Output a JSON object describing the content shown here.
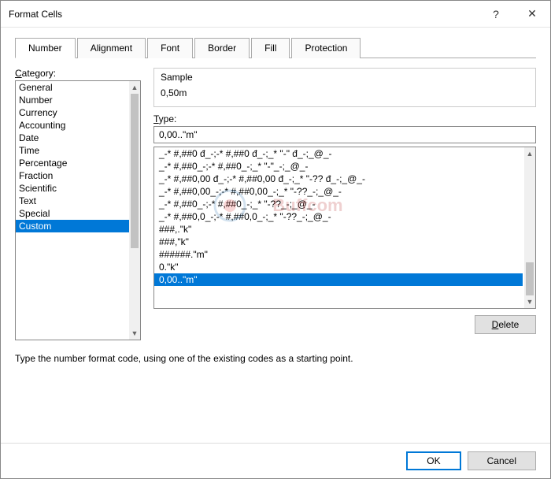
{
  "window": {
    "title": "Format Cells",
    "help_glyph": "?",
    "close_glyph": "✕"
  },
  "tabs": [
    {
      "id": "number",
      "label": "Number",
      "active": true
    },
    {
      "id": "alignment",
      "label": "Alignment",
      "active": false
    },
    {
      "id": "font",
      "label": "Font",
      "active": false
    },
    {
      "id": "border",
      "label": "Border",
      "active": false
    },
    {
      "id": "fill",
      "label": "Fill",
      "active": false
    },
    {
      "id": "protection",
      "label": "Protection",
      "active": false
    }
  ],
  "category": {
    "label": "Category:",
    "items": [
      "General",
      "Number",
      "Currency",
      "Accounting",
      "Date",
      "Time",
      "Percentage",
      "Fraction",
      "Scientific",
      "Text",
      "Special",
      "Custom"
    ],
    "selected_index": 11
  },
  "sample": {
    "label": "Sample",
    "value": "0,50m"
  },
  "type_field": {
    "label": "Type:",
    "value": "0,00..\"m\""
  },
  "format_list": {
    "items": [
      "_-* #,##0 đ_-;-* #,##0 đ_-;_* \"-\" đ_-;_@_-",
      "_-* #,##0_-;-* #,##0_-;_* \"-\"_-;_@_-",
      "_-* #,##0,00 đ_-;-* #,##0,00 đ_-;_* \"-?? đ_-;_@_-",
      "_-* #,##0,00_-;-* #,##0,00_-;_* \"-??_-;_@_-",
      "_-* #,##0_-;-* #,##0_-;_* \"-??_-;_@_-",
      "_-* #,##0,0_-;-* #,##0,0_-;_* \"-??_-;_@_-",
      "###,.\"k\"",
      "###,\"k\"",
      "######.\"m\"",
      "0.\"k\"",
      "0,00..\"m\""
    ],
    "selected_index": 10
  },
  "delete_button": {
    "label": "Delete"
  },
  "help_text": "Type the number format code, using one of the existing codes as a starting point.",
  "buttons": {
    "ok": "OK",
    "cancel": "Cancel"
  }
}
